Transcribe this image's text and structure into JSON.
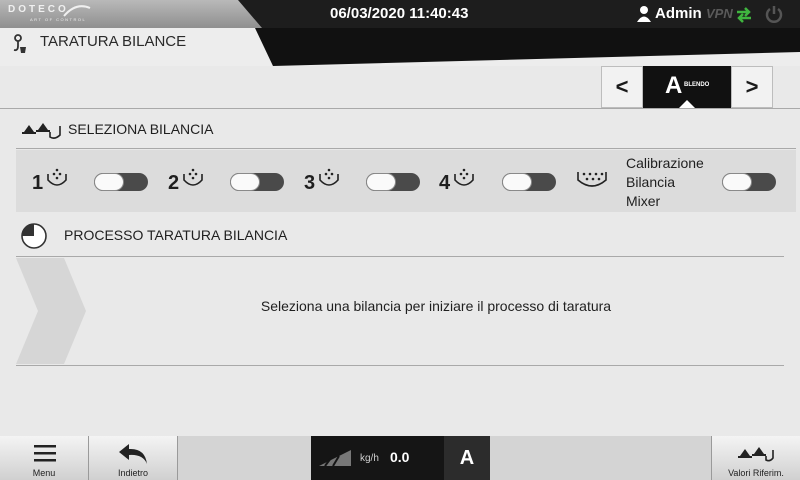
{
  "topbar": {
    "logo": "DOTECO",
    "logo_tagline": "ART OF CONTROL",
    "datetime": "06/03/2020 11:40:43",
    "user": "Admin",
    "vpn": "VPN",
    "icons": [
      "user-icon",
      "sync-icon",
      "power-icon"
    ]
  },
  "header": {
    "title": "TARATURA BILANCE"
  },
  "nav": {
    "prev": "<",
    "next": ">",
    "current_letter": "A",
    "current_sub": "BLENDO"
  },
  "select_section": {
    "title": "SELEZIONA BILANCIA",
    "scales": [
      {
        "number": "1",
        "enabled": false
      },
      {
        "number": "2",
        "enabled": false
      },
      {
        "number": "3",
        "enabled": false
      },
      {
        "number": "4",
        "enabled": false
      }
    ],
    "mixer": {
      "label_line1": "Calibrazione",
      "label_line2": "Bilancia",
      "label_line3": "Mixer",
      "enabled": false
    }
  },
  "process_section": {
    "title": "PROCESSO TARATURA BILANCIA",
    "message": "Seleziona una bilancia per iniziare il processo di taratura"
  },
  "bottombar": {
    "menu": "Menu",
    "back": "Indietro",
    "flow_unit": "kg/h",
    "flow_value": "0.0",
    "flow_letter": "A",
    "ref_values": "Valori Riferim."
  },
  "colors": {
    "topbar": "#1d1d1d",
    "background": "#e9e9e9",
    "row_highlight": "#dcdcdc",
    "accent_green": "#3fb53f"
  }
}
